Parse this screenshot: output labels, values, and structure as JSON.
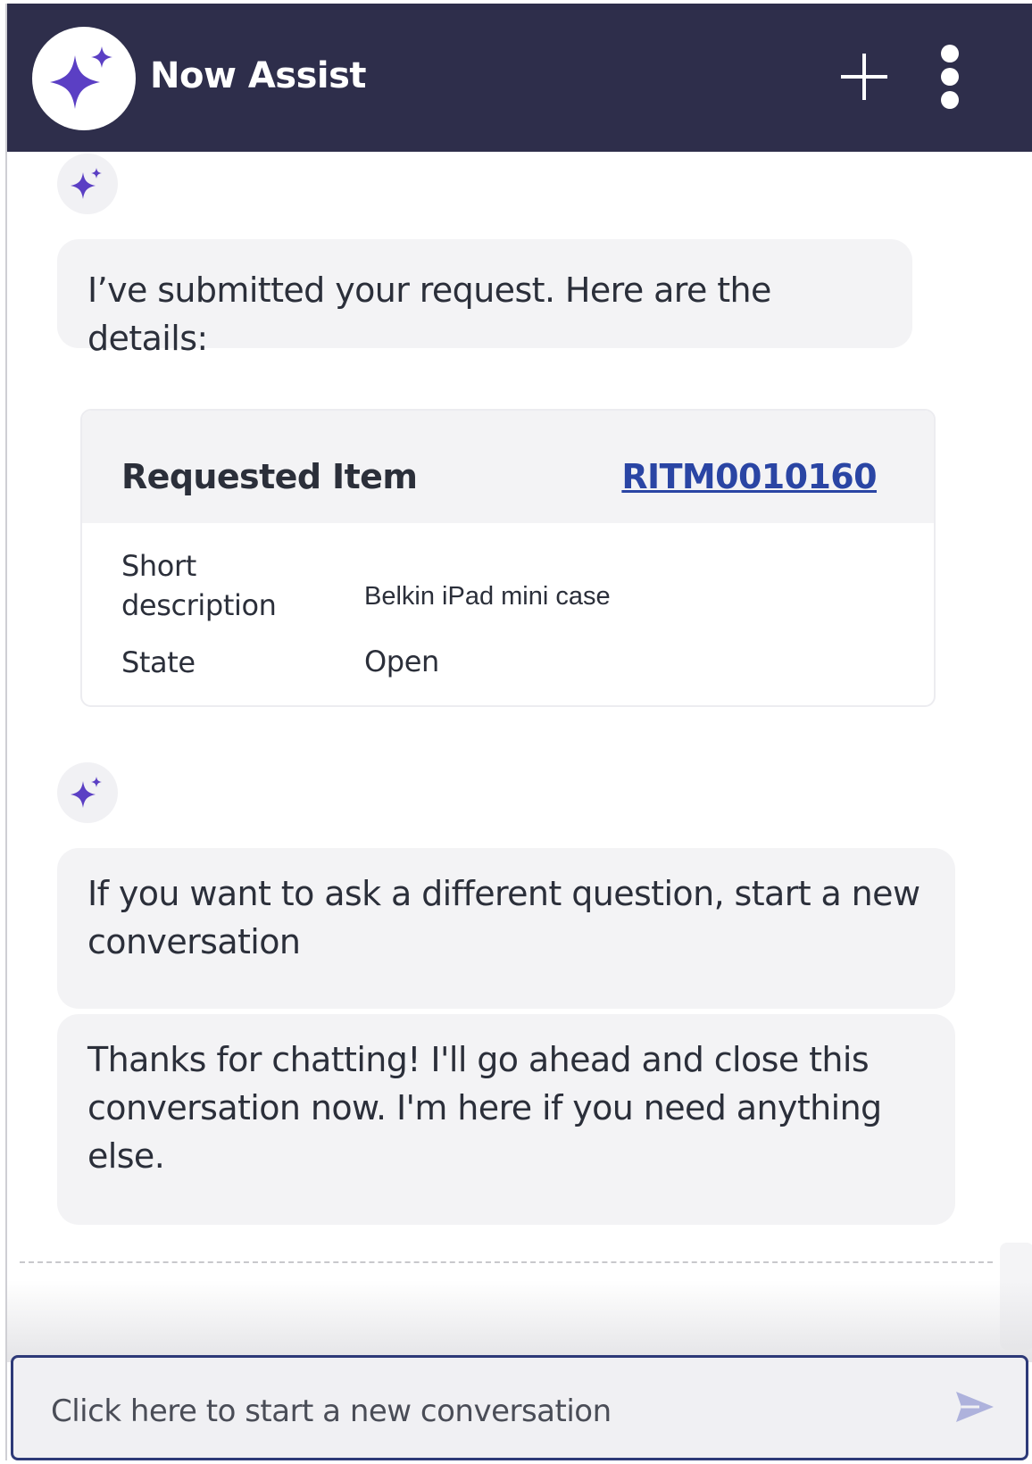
{
  "header": {
    "title": "Now Assist",
    "logo_icon": "sparkle-icon",
    "new_chat_icon": "plus-icon",
    "menu_icon": "more-vertical-icon"
  },
  "messages": [
    {
      "text": "I’ve submitted your request. Here are the details:"
    },
    {
      "text": "If you want to ask a different question, start a new conversation"
    },
    {
      "text": "Thanks for chatting! I'll go ahead and close this conversation now. I'm here if you need anything else."
    }
  ],
  "record_card": {
    "title": "Requested Item",
    "number": "RITM0010160",
    "fields": [
      {
        "label": "Short description",
        "value": "Belkin iPad mini case"
      },
      {
        "label": "State",
        "value": "Open"
      }
    ]
  },
  "composer": {
    "placeholder": "Click here to start a new conversation",
    "send_icon": "send-icon"
  },
  "colors": {
    "header_bg": "#2e2e4b",
    "accent": "#5b3fc4",
    "link": "#2a45a4",
    "bubble_bg": "#f3f3f5"
  }
}
